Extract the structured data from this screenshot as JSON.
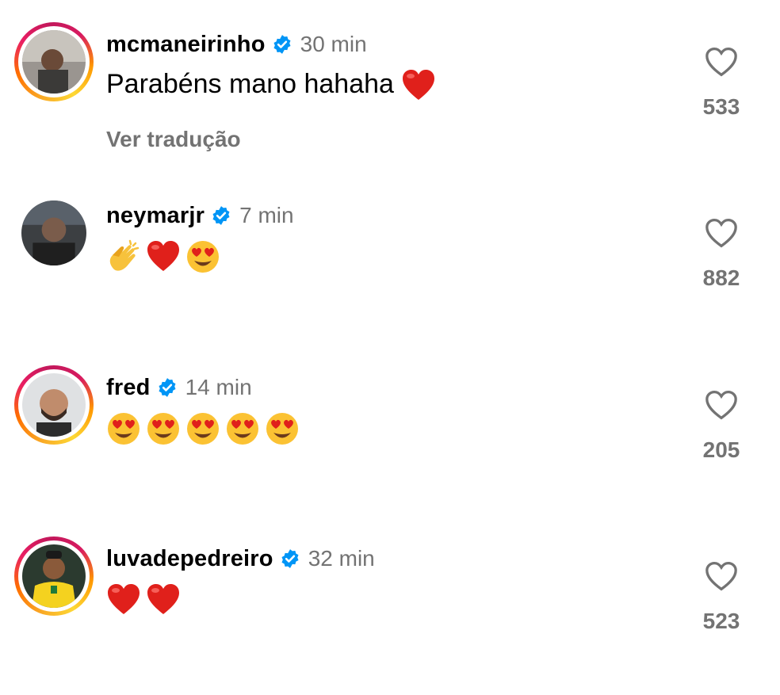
{
  "comments": [
    {
      "username": "mcmaneirinho",
      "verified": true,
      "time": "30 min",
      "text": "Parabéns mano hahaha",
      "emojis": [
        "heart"
      ],
      "translate_label": "Ver tradução",
      "likes": "533",
      "story_ring": true
    },
    {
      "username": "neymarjr",
      "verified": true,
      "time": "7 min",
      "text": "",
      "emojis": [
        "clapping-hands",
        "heart",
        "heart-eyes"
      ],
      "likes": "882",
      "story_ring": false
    },
    {
      "username": "fred",
      "verified": true,
      "time": "14 min",
      "text": "",
      "emojis": [
        "heart-eyes",
        "heart-eyes",
        "heart-eyes",
        "heart-eyes",
        "heart-eyes"
      ],
      "likes": "205",
      "story_ring": true
    },
    {
      "username": "luvadepedreiro",
      "verified": true,
      "time": "32 min",
      "text": "",
      "emojis": [
        "heart",
        "heart"
      ],
      "likes": "523",
      "story_ring": true
    }
  ],
  "colors": {
    "verified_blue": "#0095f6",
    "muted_text": "#737373",
    "heart_red": "#e0201b"
  }
}
